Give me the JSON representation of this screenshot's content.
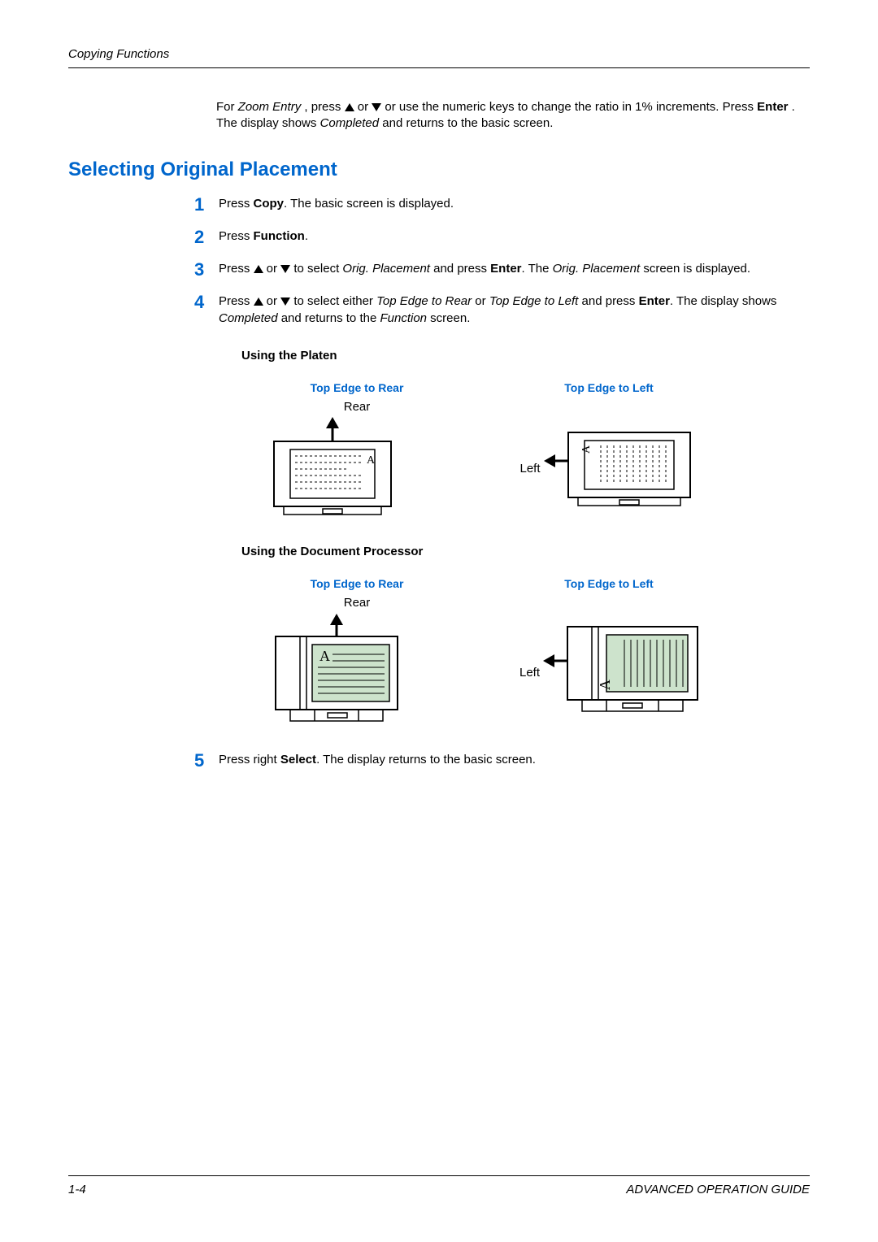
{
  "header": {
    "title": "Copying Functions"
  },
  "intro": {
    "pre": "For ",
    "zoom": "Zoom Entry",
    "mid1": ", press ",
    "mid2": " or ",
    "post1": " or use the numeric keys to change the ratio in 1% increments. Press ",
    "enter": "Enter",
    "post2": ". The display shows ",
    "completed": "Completed",
    "post3": " and returns to the basic screen."
  },
  "section_title": "Selecting Original Placement",
  "steps": {
    "s1": {
      "n": "1",
      "a": "Press ",
      "b": "Copy",
      "c": ". The basic screen is displayed."
    },
    "s2": {
      "n": "2",
      "a": "Press ",
      "b": "Function",
      "c": "."
    },
    "s3": {
      "n": "3",
      "a": "Press ",
      "b": " or ",
      "c": " to select ",
      "d": "Orig. Placement",
      "e": " and press ",
      "f": "Enter",
      "g": ". The ",
      "h": "Orig. Placement",
      "i": " screen is displayed."
    },
    "s4": {
      "n": "4",
      "a": "Press ",
      "b": " or ",
      "c": " to select either ",
      "d": "Top Edge to Rear",
      "e": " or ",
      "f": "Top Edge to Left",
      "g": " and press ",
      "h": "Enter",
      "i": ". The display shows ",
      "j": "Completed",
      "k": " and returns to the ",
      "l": "Function",
      "m": " screen."
    },
    "s5": {
      "n": "5",
      "a": "Press right ",
      "b": "Select",
      "c": ". The display returns to the basic screen."
    }
  },
  "platen": {
    "head": "Using the Platen",
    "rear_title": "Top Edge to Rear",
    "left_title": "Top Edge to Left",
    "rear_label": "Rear",
    "left_label": "Left"
  },
  "docproc": {
    "head": "Using the Document Processor",
    "rear_title": "Top Edge to Rear",
    "left_title": "Top Edge to Left",
    "rear_label": "Rear",
    "left_label": "Left"
  },
  "footer": {
    "page": "1-4",
    "guide": "ADVANCED OPERATION GUIDE"
  }
}
